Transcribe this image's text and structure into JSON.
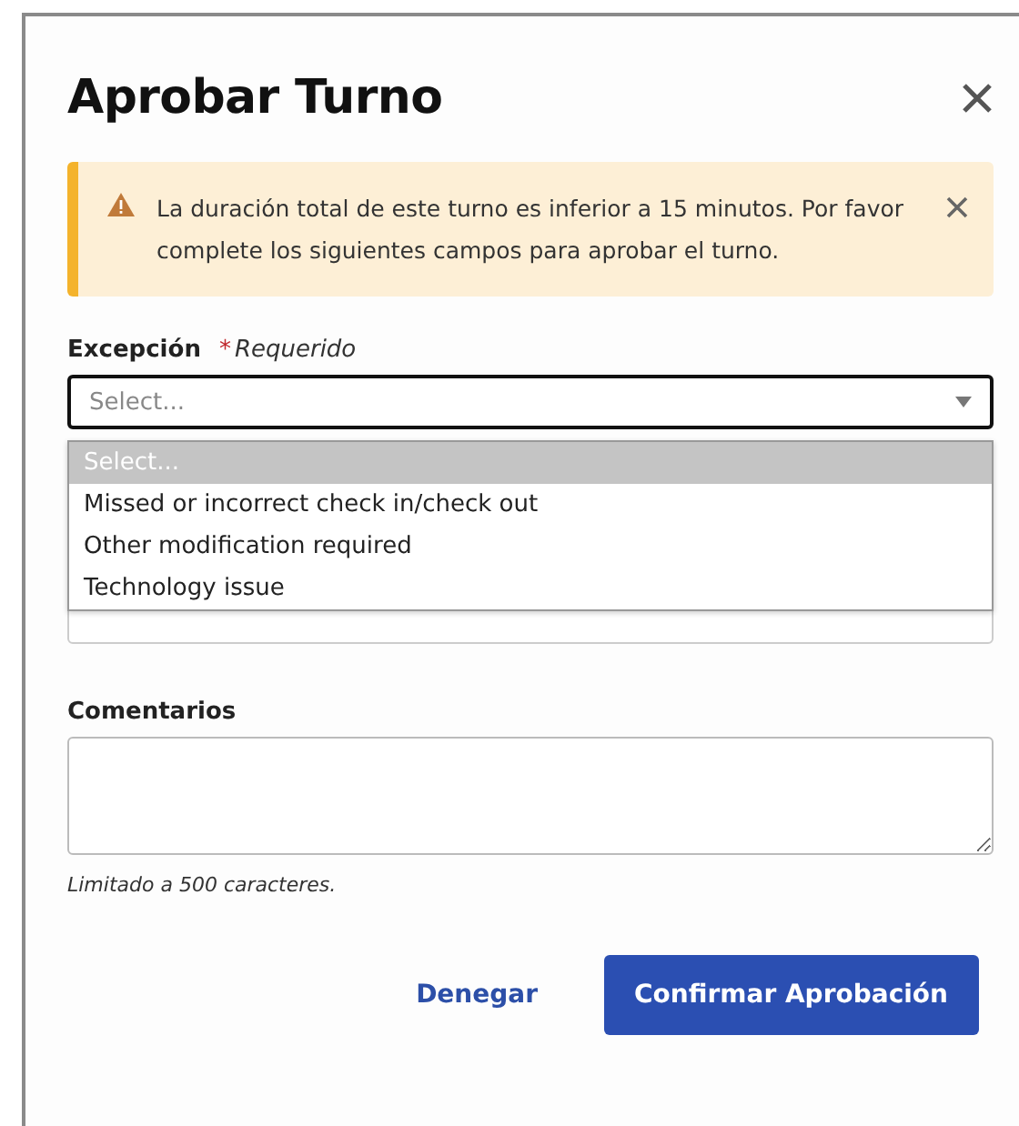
{
  "dialog": {
    "title": "Aprobar Turno"
  },
  "alert": {
    "message": "La duración total de este turno es inferior a 15 minutos. Por favor complete los siguientes campos para aprobar el turno."
  },
  "exception_field": {
    "label": "Excepción",
    "required_mark": "*",
    "required_text": "Requerido",
    "placeholder": "Select...",
    "expanded": true,
    "options": [
      {
        "label": "Select...",
        "selected": true
      },
      {
        "label": "Missed or incorrect check in/check out",
        "selected": false
      },
      {
        "label": "Other modification required",
        "selected": false
      },
      {
        "label": "Technology issue",
        "selected": false
      }
    ]
  },
  "comments_field": {
    "label": "Comentarios",
    "hint": "Limitado a 500 caracteres."
  },
  "buttons": [
    {
      "label": "Denegar",
      "kind": "link"
    },
    {
      "label": "Confirmar Aprobación",
      "kind": "primary"
    }
  ]
}
